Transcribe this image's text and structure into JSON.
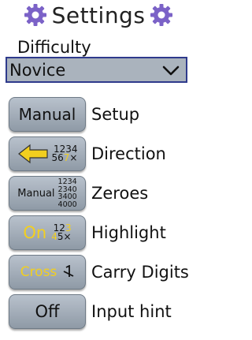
{
  "header": {
    "title": "Settings",
    "left_icon": "gear-icon",
    "right_icon": "gear-icon"
  },
  "difficulty": {
    "label": "Difficulty",
    "selected": "Novice"
  },
  "rows": [
    {
      "button_label": "Manual",
      "label": "Setup"
    },
    {
      "button_icon": "left-arrow-icon",
      "digits_top": "1234",
      "digits_bottom_a": "56",
      "digits_bottom_b": "7",
      "digits_bottom_c": "×",
      "label": "Direction"
    },
    {
      "button_label": "Manual",
      "digits": [
        "1234",
        "2340",
        "3400",
        "4000"
      ],
      "label": "Zeroes"
    },
    {
      "button_label": "On",
      "digits_top_a": "12",
      "digits_top_b": "3",
      "digits_bottom_a": "4",
      "digits_bottom_b": "5×",
      "label": "Highlight"
    },
    {
      "button_label": "Cross",
      "button_icon": "strikethrough-digit-icon",
      "label": "Carry Digits"
    },
    {
      "button_label": "Off",
      "label": "Input hint"
    }
  ],
  "colors": {
    "accent": "#7b62c7",
    "button": "#a4adb8",
    "select_border": "#2e3a8c",
    "highlight": "#f2cf1f"
  }
}
